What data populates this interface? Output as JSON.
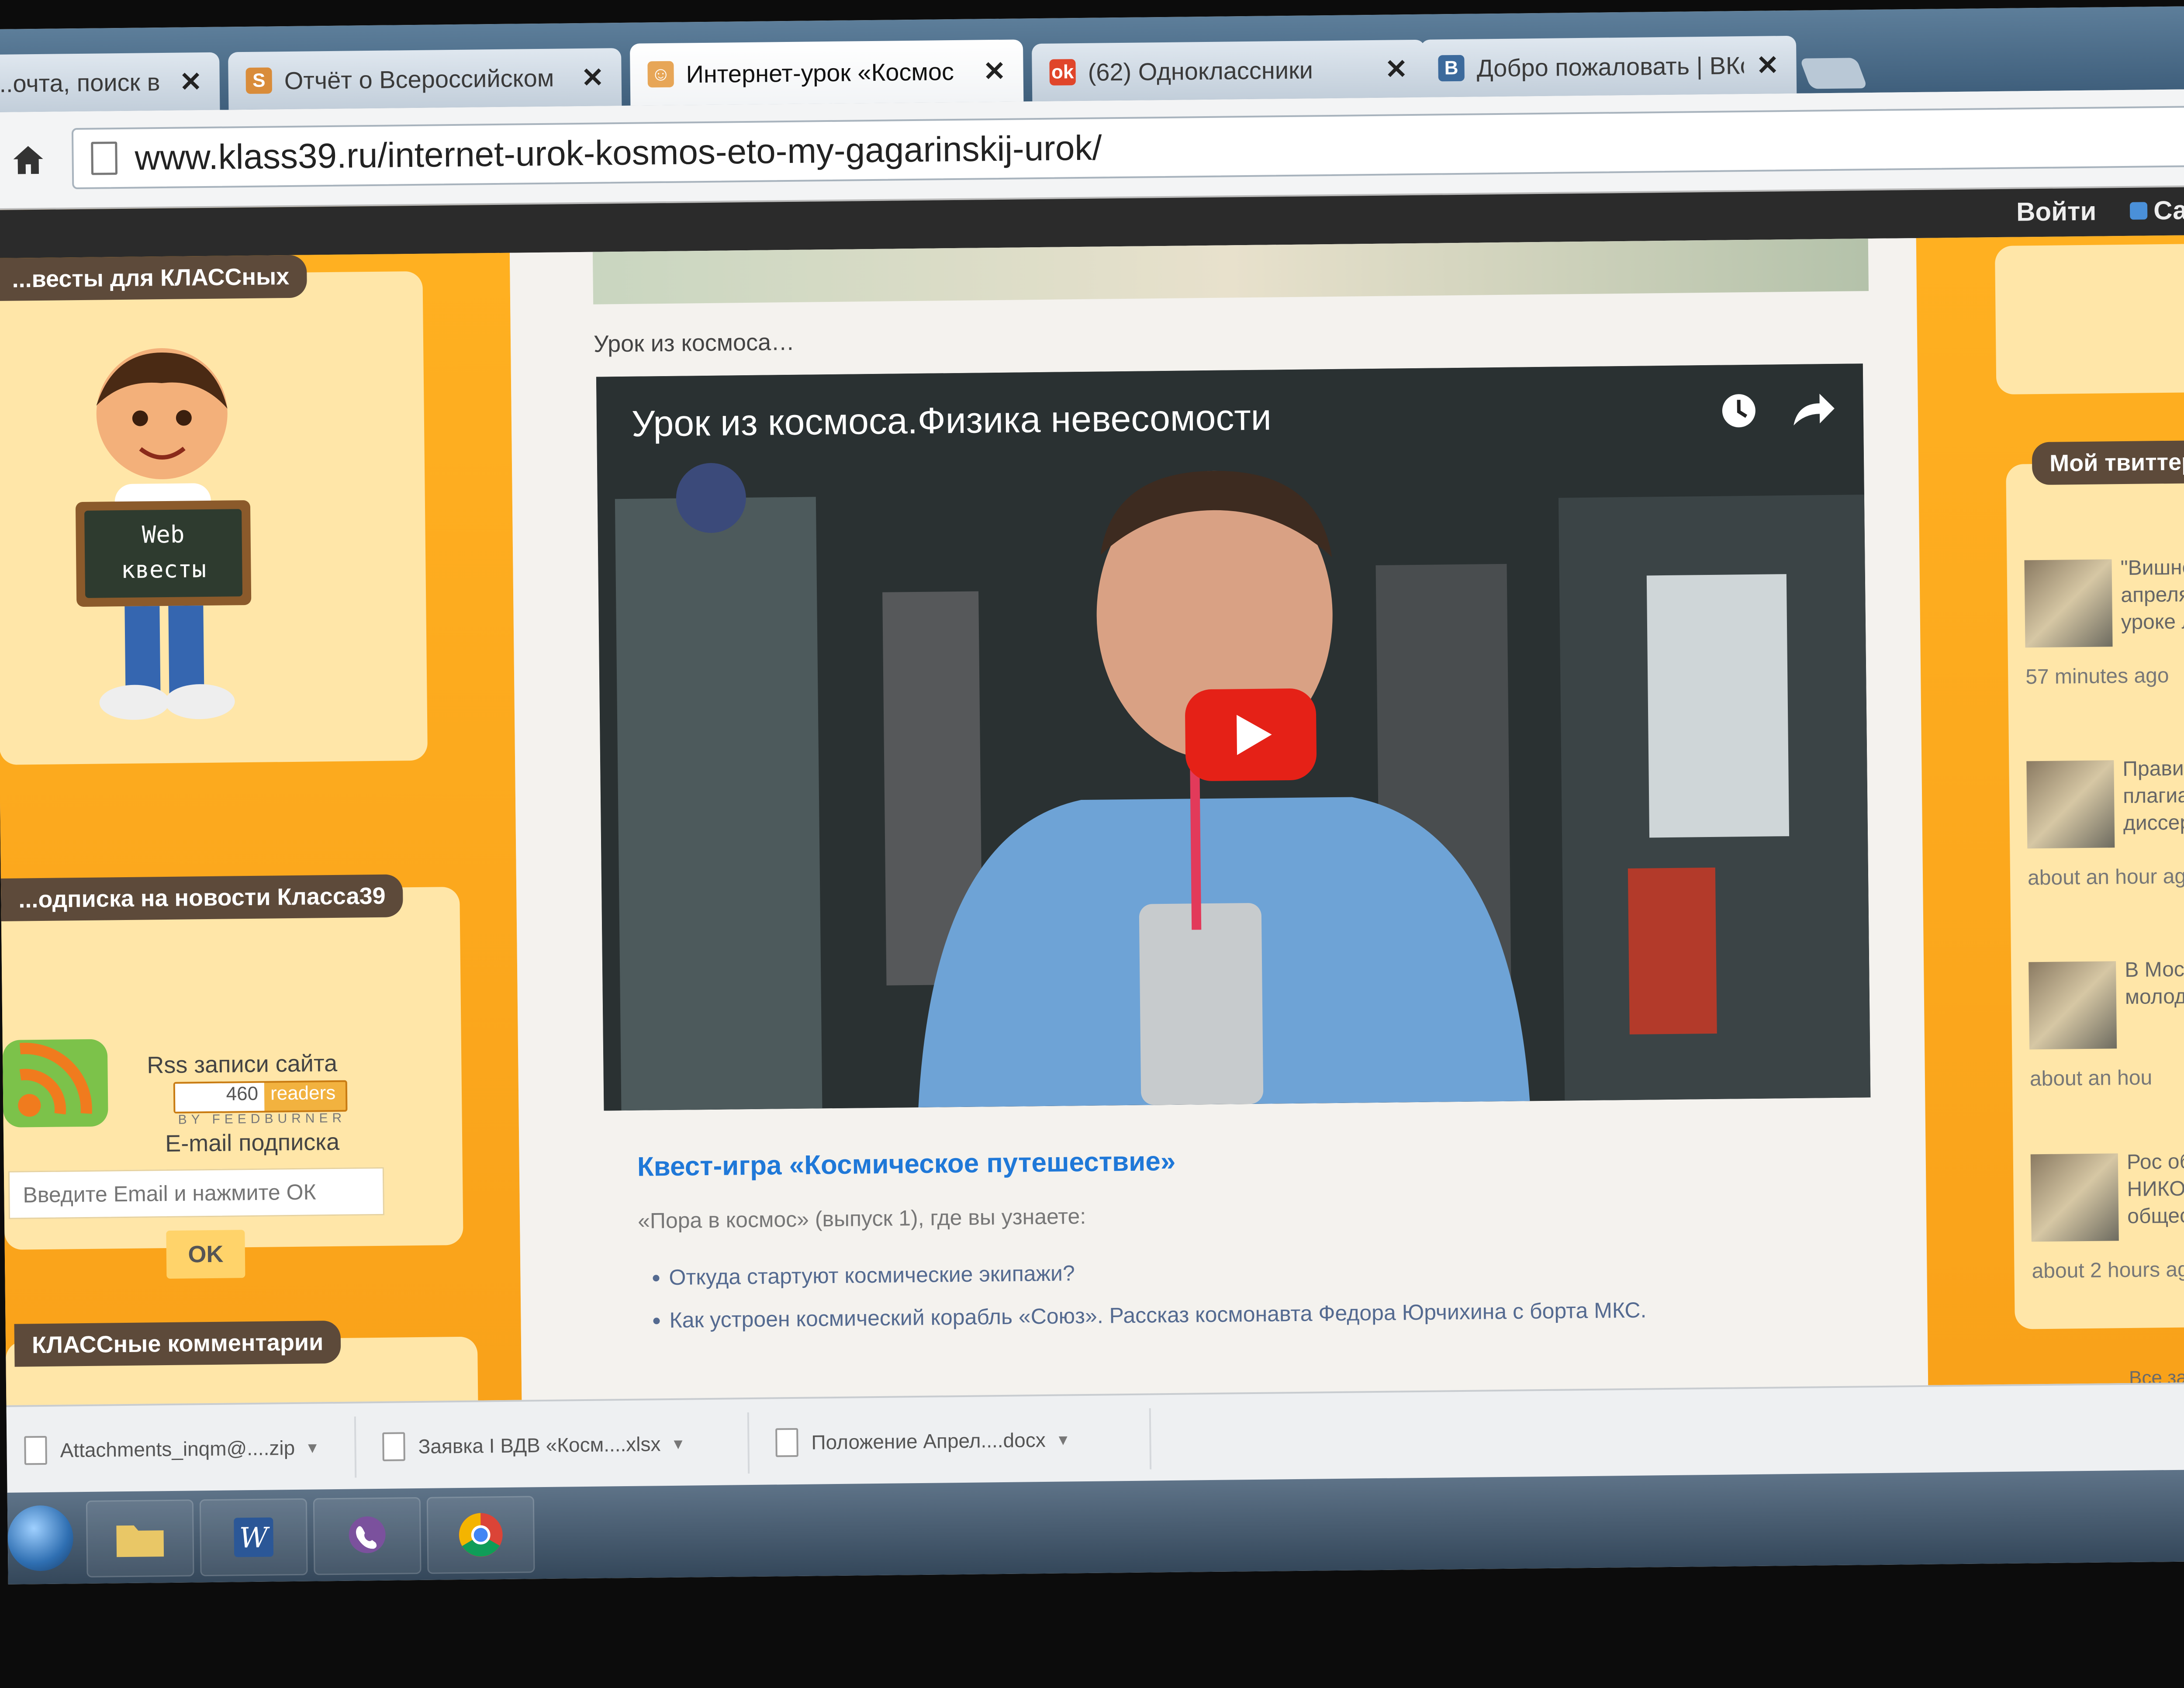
{
  "tabs": [
    {
      "title": "...очта, поиск в и",
      "favicon": "none"
    },
    {
      "title": "Отчёт о Всероссийском",
      "favicon": "s-icon"
    },
    {
      "title": "Интернет-урок «Космос",
      "favicon": "kid-icon",
      "active": true
    },
    {
      "title": "(62) Одноклассники",
      "favicon": "odnoklassniki-icon"
    },
    {
      "title": "Добро пожаловать | ВКо",
      "favicon": "vk-icon"
    }
  ],
  "address": {
    "url": "www.klass39.ru/internet-urok-kosmos-eto-my-gagarinskij-urok/"
  },
  "topbar": {
    "login": "Войти",
    "site": "Сайт"
  },
  "left": {
    "quests_title": "...весты для КЛАССных",
    "board_text_1": "Web",
    "board_text_2": "квесты",
    "subscribe_title": "...одписка на новости Класса39",
    "rss_label": "Rss записи сайта",
    "readers_count": "460",
    "readers_label": "readers",
    "feedburner": "BY FEEDBURNER",
    "email_label": "E-mail подписка",
    "email_placeholder": "Введите Email и нажмите ОК",
    "ok_button": "OK",
    "comments_title": "КЛАССные комментарии"
  },
  "content": {
    "intro": "Урок из космоса…",
    "video_title": "Урок из космоса.Физика невесомости",
    "quest_link": "Квест-игра «Космическое путешествие»",
    "release_text": "«Пора в космос» (выпуск 1), где вы узнаете:",
    "bullets": [
      "Откуда стартуют космические экипажи?",
      "Как устроен космический корабль «Союз». Рассказ космонавта Федора Юрчихина с борта МКС."
    ]
  },
  "right": {
    "twitter_title": "Мой твиттер @kla",
    "tweets": [
      {
        "text": "\"Вишневь апреля на уроке лит",
        "time": "57 minutes ago"
      },
      {
        "text": "Правитель плагиатом диссертац",
        "time": "about an hour ago"
      },
      {
        "text": "В Москве молодых лк",
        "time": "about an hou"
      },
      {
        "text": "Рос обрнадз НИКО по ис общественн классах",
        "time": "about 2 hours ago"
      }
    ],
    "download_all": "Все загру"
  },
  "downloads": [
    {
      "name": "Attachments_inqm@....zip"
    },
    {
      "name": "Заявка I ВДВ «Косм....xlsx"
    },
    {
      "name": "Положение Апрел....docx"
    }
  ],
  "colors": {
    "accent_orange": "#ffb021",
    "youtube_red": "#e52117",
    "link_blue": "#1f78d8"
  }
}
